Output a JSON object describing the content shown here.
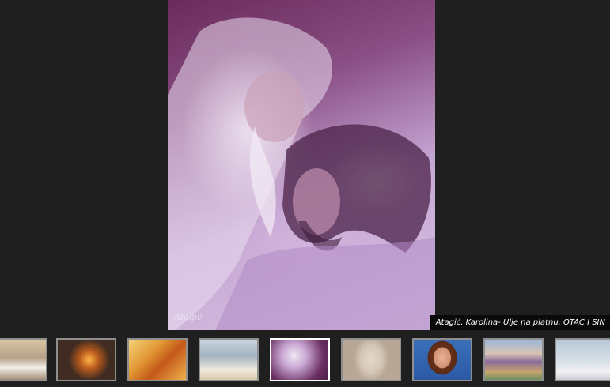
{
  "gallery": {
    "caption": "Atagić, Karolina- Ulje na platnu, OTAC I SIN",
    "signature": "Atagić",
    "thumbnails": [
      {
        "name": "winter-village",
        "active": false
      },
      {
        "name": "sunset-snow",
        "active": false
      },
      {
        "name": "golden-abstract",
        "active": false
      },
      {
        "name": "winter-trees",
        "active": false
      },
      {
        "name": "father-and-son",
        "active": true
      },
      {
        "name": "woman-portrait-sketch",
        "active": false
      },
      {
        "name": "woman-portrait-color",
        "active": false
      },
      {
        "name": "landscape-impression",
        "active": false
      },
      {
        "name": "church-winter",
        "active": false
      }
    ]
  }
}
